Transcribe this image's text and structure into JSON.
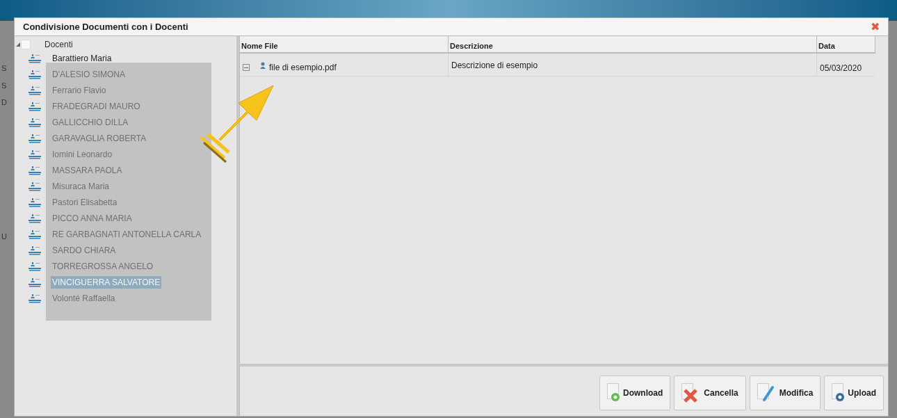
{
  "background_labels": [
    {
      "text": "S"
    },
    {
      "text": "S"
    },
    {
      "text": "D"
    },
    {
      "text": "U"
    }
  ],
  "window": {
    "title": "Condivisione Documenti con i Docenti",
    "close": "✖"
  },
  "tree": {
    "root": {
      "label": "Docenti",
      "checked": false,
      "expanded": true
    },
    "children": [
      {
        "label": "Barattiero Maria",
        "selected": false
      },
      {
        "label": "D'ALESIO SIMONA",
        "selected": false
      },
      {
        "label": "Ferrario Flavio",
        "selected": false
      },
      {
        "label": "FRADEGRADI MAURO",
        "selected": false
      },
      {
        "label": "GALLICCHIO DILLA",
        "selected": false
      },
      {
        "label": "GARAVAGLIA ROBERTA",
        "selected": false
      },
      {
        "label": "Iomini Leonardo",
        "selected": false
      },
      {
        "label": "MASSARA PAOLA",
        "selected": false
      },
      {
        "label": "Misuraca Maria",
        "selected": false
      },
      {
        "label": "Pastori Elisabetta",
        "selected": false
      },
      {
        "label": "PICCO ANNA MARIA",
        "selected": false
      },
      {
        "label": "RE GARBAGNATI ANTONELLA CARLA",
        "selected": false
      },
      {
        "label": "SARDO CHIARA",
        "selected": false
      },
      {
        "label": "TORREGROSSA ANGELO",
        "selected": false
      },
      {
        "label": "VINCIGUERRA SALVATORE",
        "selected": true
      },
      {
        "label": "Volonté Raffaella",
        "selected": false
      }
    ]
  },
  "table": {
    "columns": [
      "Nome File",
      "Descrizione",
      "Data"
    ],
    "rows": [
      {
        "expanded": true,
        "cells": [
          "file di esempio.pdf",
          "Descrizione di esempio",
          "05/03/2020"
        ]
      }
    ]
  },
  "buttons": [
    {
      "kind": "download",
      "label": "Download"
    },
    {
      "kind": "delete",
      "label": "Cancella"
    },
    {
      "kind": "edit",
      "label": "Modifica"
    },
    {
      "kind": "upload",
      "label": "Upload"
    }
  ]
}
